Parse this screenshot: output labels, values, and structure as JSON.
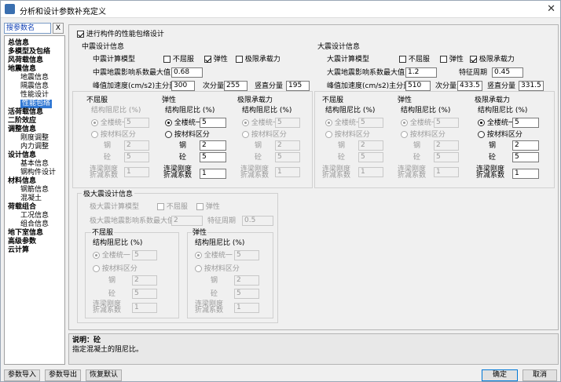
{
  "window": {
    "title": "分析和设计参数补充定义"
  },
  "search": {
    "value": "搜参数名",
    "clear": "X"
  },
  "sidebar": {
    "items": [
      {
        "label": "总信息"
      },
      {
        "label": "多模型及包络"
      },
      {
        "label": "风荷载信息"
      },
      {
        "label": "地震信息"
      },
      {
        "label": "地震信息"
      },
      {
        "label": "隔震信息"
      },
      {
        "label": "性能设计"
      },
      {
        "label": "性能包络"
      },
      {
        "label": "活荷载信息"
      },
      {
        "label": "二阶效应"
      },
      {
        "label": "调整信息"
      },
      {
        "label": "刚度调整"
      },
      {
        "label": "内力调整"
      },
      {
        "label": "设计信息"
      },
      {
        "label": "基本信息"
      },
      {
        "label": "钢构件设计"
      },
      {
        "label": "材料信息"
      },
      {
        "label": "钢筋信息"
      },
      {
        "label": "混凝土"
      },
      {
        "label": "荷载组合"
      },
      {
        "label": "工况信息"
      },
      {
        "label": "组合信息"
      },
      {
        "label": "地下室信息"
      },
      {
        "label": "高级参数"
      },
      {
        "label": "云计算"
      }
    ]
  },
  "main": {
    "envelope_check": "进行构件的性能包络设计",
    "mid": {
      "title": "中震设计信息",
      "model_label": "中震计算模型",
      "opt1": "不屈服",
      "opt2": "弹性",
      "opt3": "极限承载力",
      "coef_label": "中震地震影响系数最大值",
      "coef_value": "0.68",
      "peak_label": "峰值加速度(cm/s2)主分量",
      "peak_main": "300",
      "sub_label": "次分量",
      "peak_sub": "255",
      "vert_label": "竖直分量",
      "peak_vert": "195",
      "g1": {
        "title": "不屈服",
        "damp": "结构阻尼比 (%)",
        "unified": "全楼统一",
        "unified_val": "5",
        "bymat": "按材料区分",
        "steel": "钢",
        "steel_val": "2",
        "conc": "砼",
        "conc_val": "5",
        "beam1": "连梁刚度",
        "beam2": "折减系数",
        "beam_val": "1"
      },
      "g2": {
        "title": "弹性",
        "damp": "结构阻尼比 (%)",
        "unified": "全楼统一",
        "unified_val": "5",
        "bymat": "按材料区分",
        "steel": "钢",
        "steel_val": "2",
        "conc": "砼",
        "conc_val": "5",
        "beam1": "连梁刚度",
        "beam2": "折减系数",
        "beam_val": "1"
      },
      "g3": {
        "title": "极限承载力",
        "damp": "结构阻尼比 (%)",
        "unified": "全楼统一",
        "unified_val": "5",
        "bymat": "按材料区分",
        "steel": "钢",
        "steel_val": "2",
        "conc": "砼",
        "conc_val": "5",
        "beam1": "连梁刚度",
        "beam2": "折减系数",
        "beam_val": "1"
      }
    },
    "big": {
      "title": "大震设计信息",
      "model_label": "大震计算模型",
      "opt1": "不屈服",
      "opt2": "弹性",
      "opt3": "极限承载力",
      "coef_label": "大震地震影响系数最大值",
      "coef_value": "1.2",
      "period_label": "特征周期",
      "period_value": "0.45",
      "peak_label": "峰值加速度(cm/s2)主分量",
      "peak_main": "510",
      "sub_label": "次分量",
      "peak_sub": "433.5",
      "vert_label": "竖直分量",
      "peak_vert": "331.5",
      "g1": {
        "title": "不屈服",
        "damp": "结构阻尼比 (%)",
        "unified": "全楼统一",
        "unified_val": "5",
        "bymat": "按材料区分",
        "steel": "钢",
        "steel_val": "2",
        "conc": "砼",
        "conc_val": "5",
        "beam1": "连梁刚度",
        "beam2": "折减系数",
        "beam_val": "1"
      },
      "g2": {
        "title": "弹性",
        "damp": "结构阻尼比 (%)",
        "unified": "全楼统一",
        "unified_val": "5",
        "bymat": "按材料区分",
        "steel": "钢",
        "steel_val": "2",
        "conc": "砼",
        "conc_val": "5",
        "beam1": "连梁刚度",
        "beam2": "折减系数",
        "beam_val": "1"
      },
      "g3": {
        "title": "极限承载力",
        "damp": "结构阻尼比 (%)",
        "unified": "全楼统一",
        "unified_val": "5",
        "bymat": "按材料区分",
        "steel": "钢",
        "steel_val": "2",
        "conc": "砼",
        "conc_val": "5",
        "beam1": "连梁刚度",
        "beam2": "折减系数",
        "beam_val": "1"
      }
    },
    "rare": {
      "title": "极大震设计信息",
      "model_label": "极大震计算模型",
      "opt1": "不屈服",
      "opt2": "弹性",
      "coef_label": "极大震地震影响系数最大值",
      "coef_value": "2",
      "period_label": "特征周期",
      "period_value": "0.5",
      "g1": {
        "title": "不屈服",
        "damp": "结构阻尼比 (%)",
        "unified": "全楼统一",
        "unified_val": "5",
        "bymat": "按材料区分",
        "steel": "钢",
        "steel_val": "2",
        "conc": "砼",
        "conc_val": "5",
        "beam1": "连梁刚度",
        "beam2": "折减系数",
        "beam_val": "1"
      },
      "g2": {
        "title": "弹性",
        "damp": "结构阻尼比 (%)",
        "unified": "全楼统一",
        "unified_val": "5",
        "bymat": "按材料区分",
        "steel": "钢",
        "steel_val": "2",
        "conc": "砼",
        "conc_val": "5",
        "beam1": "连梁刚度",
        "beam2": "折减系数",
        "beam_val": "1"
      }
    }
  },
  "desc": {
    "title": "说明：砼",
    "text": "指定混凝土的阻尼比。"
  },
  "buttons": {
    "import": "参数导入",
    "export": "参数导出",
    "restore": "恢复默认",
    "ok": "确定",
    "cancel": "取消"
  }
}
